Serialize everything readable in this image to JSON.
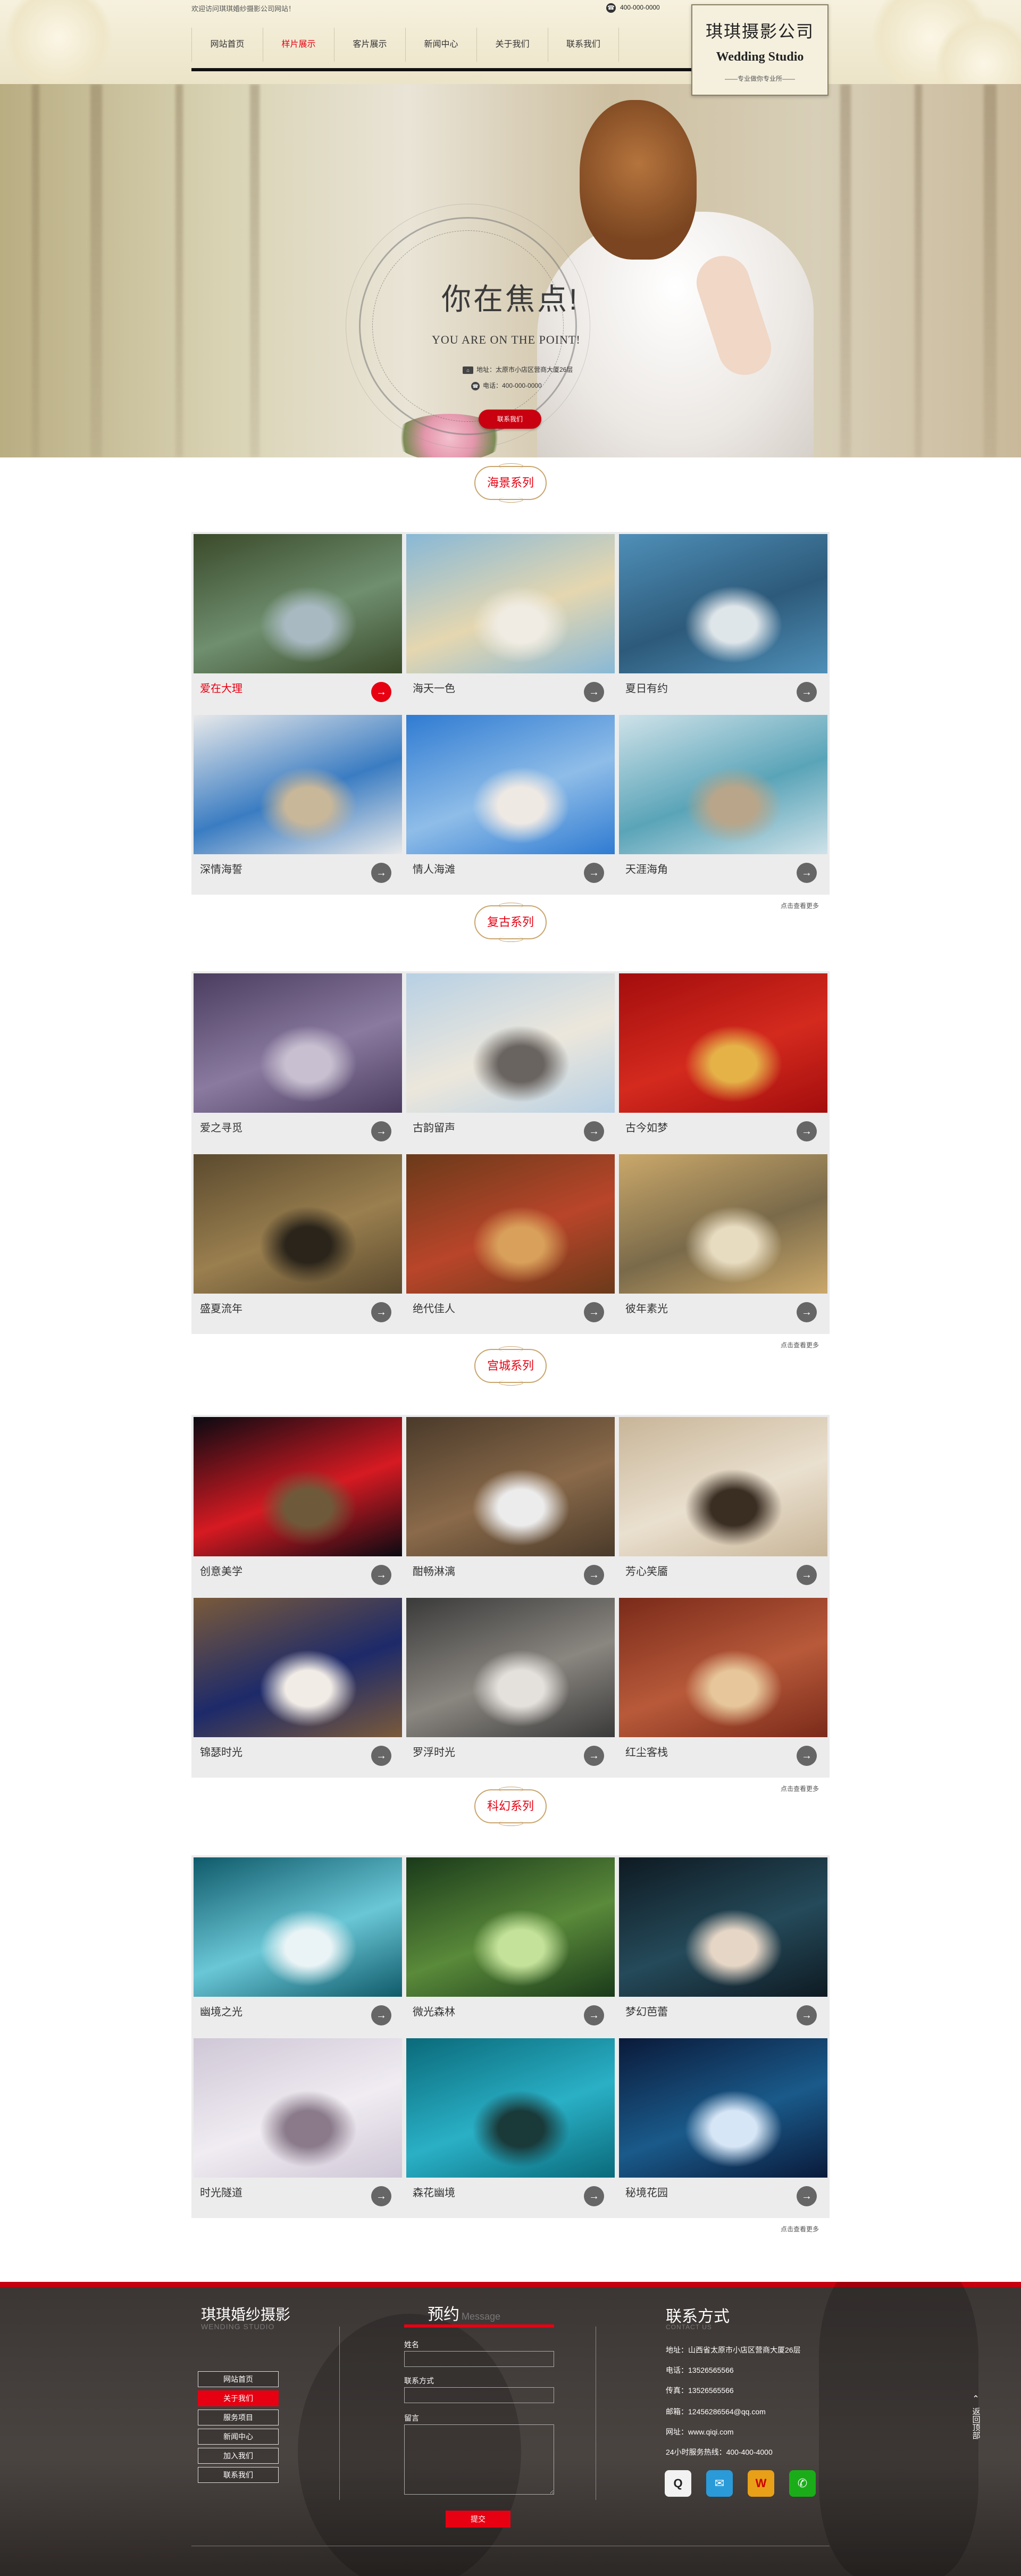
{
  "header": {
    "welcome": "欢迎访问琪琪婚纱摄影公司网站！",
    "phone": "400-000-0000",
    "nav": [
      "网站首页",
      "样片展示",
      "客片展示",
      "新闻中心",
      "关于我们",
      "联系我们"
    ],
    "nav_active_index": 1,
    "logo_cn": "琪琪摄影公司",
    "logo_en": "Wedding Studio",
    "logo_sub": "——专业做你专业所——"
  },
  "hero": {
    "title": "你在焦点!",
    "subtitle": "YOU ARE ON THE POINT!",
    "address": "地址：太原市小店区营商大厦26层",
    "tel": "电话：400-000-0000",
    "button": "联系我们"
  },
  "sections": [
    {
      "title": "海景系列",
      "items": [
        {
          "label": "爱在大理",
          "highlight": true,
          "colors": [
            "#3a4a2a",
            "#6f8f6f",
            "#a8b9c1"
          ]
        },
        {
          "label": "海天一色",
          "highlight": false,
          "colors": [
            "#88b8d6",
            "#e5d7b0",
            "#f0ece3"
          ]
        },
        {
          "label": "夏日有约",
          "highlight": false,
          "colors": [
            "#4f8fb8",
            "#2d5a7a",
            "#dfe6ea"
          ]
        },
        {
          "label": "深情海誓",
          "highlight": false,
          "colors": [
            "#e8e9ea",
            "#3a7cc2",
            "#c9b79a"
          ]
        },
        {
          "label": "情人海滩",
          "highlight": false,
          "colors": [
            "#2f7bd2",
            "#8fbde8",
            "#efe9e4"
          ]
        },
        {
          "label": "天涯海角",
          "highlight": false,
          "colors": [
            "#cfe2e9",
            "#5aa4b8",
            "#b9a68a"
          ]
        }
      ],
      "more": "点击查看更多"
    },
    {
      "title": "复古系列",
      "items": [
        {
          "label": "爱之寻觅",
          "highlight": false,
          "colors": [
            "#4a3d5e",
            "#8a7aa0",
            "#c8c0d0"
          ]
        },
        {
          "label": "古韵留声",
          "highlight": false,
          "colors": [
            "#b7d0e4",
            "#ece7dc",
            "#6a6460"
          ]
        },
        {
          "label": "古今如梦",
          "highlight": false,
          "colors": [
            "#a30d0d",
            "#d42a1e",
            "#e5b248"
          ]
        },
        {
          "label": "盛夏流年",
          "highlight": false,
          "colors": [
            "#5b4a2e",
            "#9a7f4f",
            "#2a241a"
          ]
        },
        {
          "label": "绝代佳人",
          "highlight": false,
          "colors": [
            "#6a3a1a",
            "#b9452a",
            "#d8a05a"
          ]
        },
        {
          "label": "彼年素光",
          "highlight": false,
          "colors": [
            "#caa86a",
            "#7a6a4a",
            "#e8dcc0"
          ]
        }
      ],
      "more": "点击查看更多"
    },
    {
      "title": "宫城系列",
      "items": [
        {
          "label": "创意美学",
          "highlight": false,
          "colors": [
            "#0a0a12",
            "#d61a22",
            "#6e5a3a"
          ]
        },
        {
          "label": "酣畅淋漓",
          "highlight": false,
          "colors": [
            "#4a3a2a",
            "#8a6a4a",
            "#ececec"
          ]
        },
        {
          "label": "芳心笑靥",
          "highlight": false,
          "colors": [
            "#c8b598",
            "#eae0cf",
            "#3a2d22"
          ]
        },
        {
          "label": "锦瑟时光",
          "highlight": false,
          "colors": [
            "#7a5a3a",
            "#1d2a6a",
            "#f2ece6"
          ]
        },
        {
          "label": "罗浮时光",
          "highlight": false,
          "colors": [
            "#3a3a3a",
            "#8a8680",
            "#e4e0dc"
          ]
        },
        {
          "label": "红尘客栈",
          "highlight": false,
          "colors": [
            "#7a2a1a",
            "#b85a3a",
            "#e6c69a"
          ]
        }
      ],
      "more": "点击查看更多"
    },
    {
      "title": "科幻系列",
      "items": [
        {
          "label": "幽境之光",
          "highlight": false,
          "colors": [
            "#0f5a6a",
            "#6ac7d6",
            "#eaf4f6"
          ]
        },
        {
          "label": "微光森林",
          "highlight": false,
          "colors": [
            "#1a3a1a",
            "#5a8a3a",
            "#c4e29a"
          ]
        },
        {
          "label": "梦幻芭蕾",
          "highlight": false,
          "colors": [
            "#0e1a22",
            "#254a5a",
            "#e6d6c6"
          ]
        },
        {
          "label": "时光隧道",
          "highlight": false,
          "colors": [
            "#cfc7d6",
            "#f0ecf2",
            "#8a7a8a"
          ]
        },
        {
          "label": "森花幽境",
          "highlight": false,
          "colors": [
            "#0a6a7a",
            "#2ab0c6",
            "#1a3a3a"
          ]
        },
        {
          "label": "秘境花园",
          "highlight": false,
          "colors": [
            "#0a1a3a",
            "#1a5a8a",
            "#d6e6f6"
          ]
        }
      ],
      "more": "点击查看更多"
    }
  ],
  "footer": {
    "brand": "琪琪婚纱摄影",
    "brand_en": "WENDING STUDIO",
    "menu": [
      "网站首页",
      "关于我们",
      "服务项目",
      "新闻中心",
      "加入我们",
      "联系我们"
    ],
    "menu_active_index": 1,
    "message_title": "预约",
    "message_en": "Message",
    "field_name": "姓名",
    "field_contact": "联系方式",
    "field_message": "留言",
    "submit": "提交",
    "contact_title": "联系方式",
    "contact_en": "CONTACT US",
    "contact_lines": [
      "地址：山西省太原市小店区营商大厦26层",
      "电话：13526565566",
      "传真：13526565566",
      "邮箱：12456286564@qq.com",
      "网址：www.qiqi.com",
      "24小时服务热线：400-400-4000"
    ],
    "social_icons": [
      "qq-icon",
      "mail-icon",
      "weibo-icon",
      "wechat-icon"
    ],
    "back_to_top": "返回顶部",
    "accent_color": "#e60012"
  }
}
